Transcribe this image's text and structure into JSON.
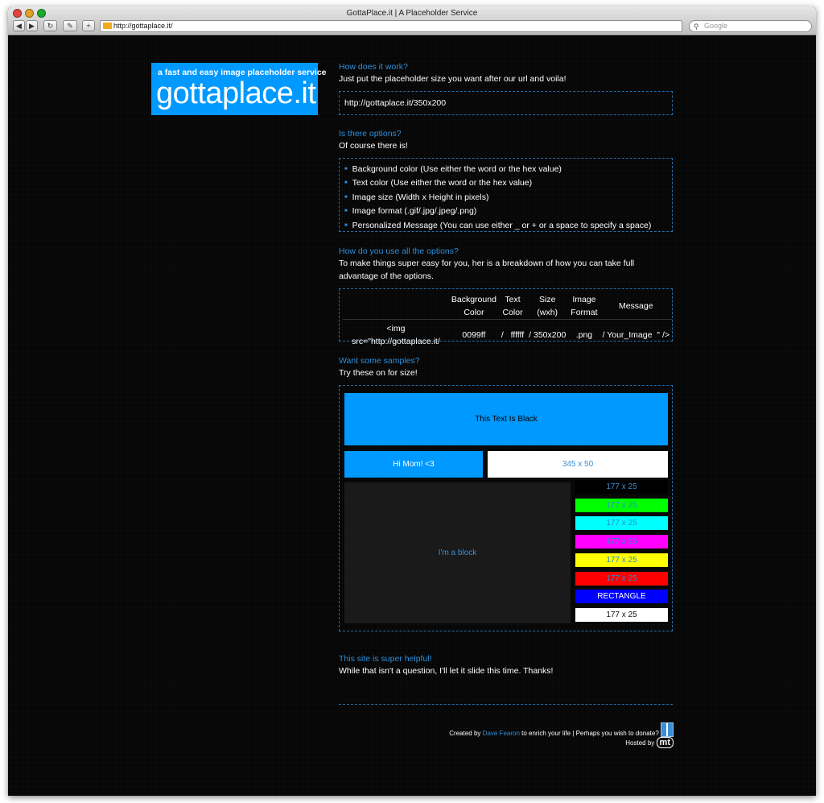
{
  "browser": {
    "window_title": "GottaPlace.it | A Placeholder Service",
    "url": "http://gottaplace.it/",
    "search_placeholder": "Google"
  },
  "logo": {
    "tagline": "a fast and easy image placeholder service",
    "name": "gottaplace.it",
    "color": "#0099ff"
  },
  "faq": {
    "q1": "How does it work?",
    "a1": "Just put the placeholder size you want after our url and voila!",
    "example_url": "http://gottaplace.it/350x200",
    "q2": "Is there options?",
    "a2": "Of course there is!",
    "options": [
      "Background color (Use either the word or the hex value)",
      "Text color (Use either the word or the hex value)",
      "Image size (Width x Height in pixels)",
      "Image format (.gif/.jpg/.jpeg/.png)",
      "Personalized Message (You can use either _ or + or a space to specify a space)"
    ],
    "q3": "How do you use all the options?",
    "a3": "To make things super easy for you, her is a breakdown of how you can take full advantage of the options.",
    "breakdown": {
      "headers": {
        "bg_1": "Background",
        "bg_2": "Color",
        "tc_1": "Text",
        "tc_2": "Color",
        "size_1": "Size",
        "size_2": "(wxh)",
        "fmt_1": "Image",
        "fmt_2": "Format",
        "msg": "Message"
      },
      "row": {
        "prefix": "<img src=\"http://gottaplace.it/",
        "bg": "0099ff",
        "sep1": "/",
        "tc": "ffffff",
        "size": "/ 350x200",
        "fmt": ".png",
        "msg": "/ Your_Image",
        "suffix": "\" />"
      }
    },
    "q4": "Want some samples?",
    "a4": "Try these on for size!",
    "samples": {
      "wide": "This Text Is Black",
      "mom": "Hi Mom! <3",
      "white": "345 x 50",
      "block": "I'm a block",
      "rects": [
        {
          "label": "177 x 25",
          "bg": "#000000",
          "fg": "#3a8fd6"
        },
        {
          "label": "177 x 25",
          "bg": "#00ff00",
          "fg": "#2a8fd0"
        },
        {
          "label": "177 x 25",
          "bg": "#00ffff",
          "fg": "#2a8fd0"
        },
        {
          "label": "177 x 25",
          "bg": "#ff00ff",
          "fg": "#2a8fd0"
        },
        {
          "label": "177 x 25",
          "bg": "#ffff00",
          "fg": "#2a8fd0"
        },
        {
          "label": "177 x 25",
          "bg": "#ff0000",
          "fg": "#2a8fd0"
        },
        {
          "label": "RECTANGLE",
          "bg": "#0000ff",
          "fg": "#ffffff"
        },
        {
          "label": "177 x 25",
          "bg": "#ffffff",
          "fg": "#111111"
        }
      ]
    },
    "q5": "This site is super helpful!",
    "a5": "While that isn't a question, I'll let it slide this time. Thanks!"
  },
  "footer": {
    "created_by": "Created by",
    "author": "Dave Fearon",
    "rest": "to enrich your life | Perhaps you wish to donate?",
    "hosted_by": "Hosted by",
    "host_logo": "mt"
  }
}
